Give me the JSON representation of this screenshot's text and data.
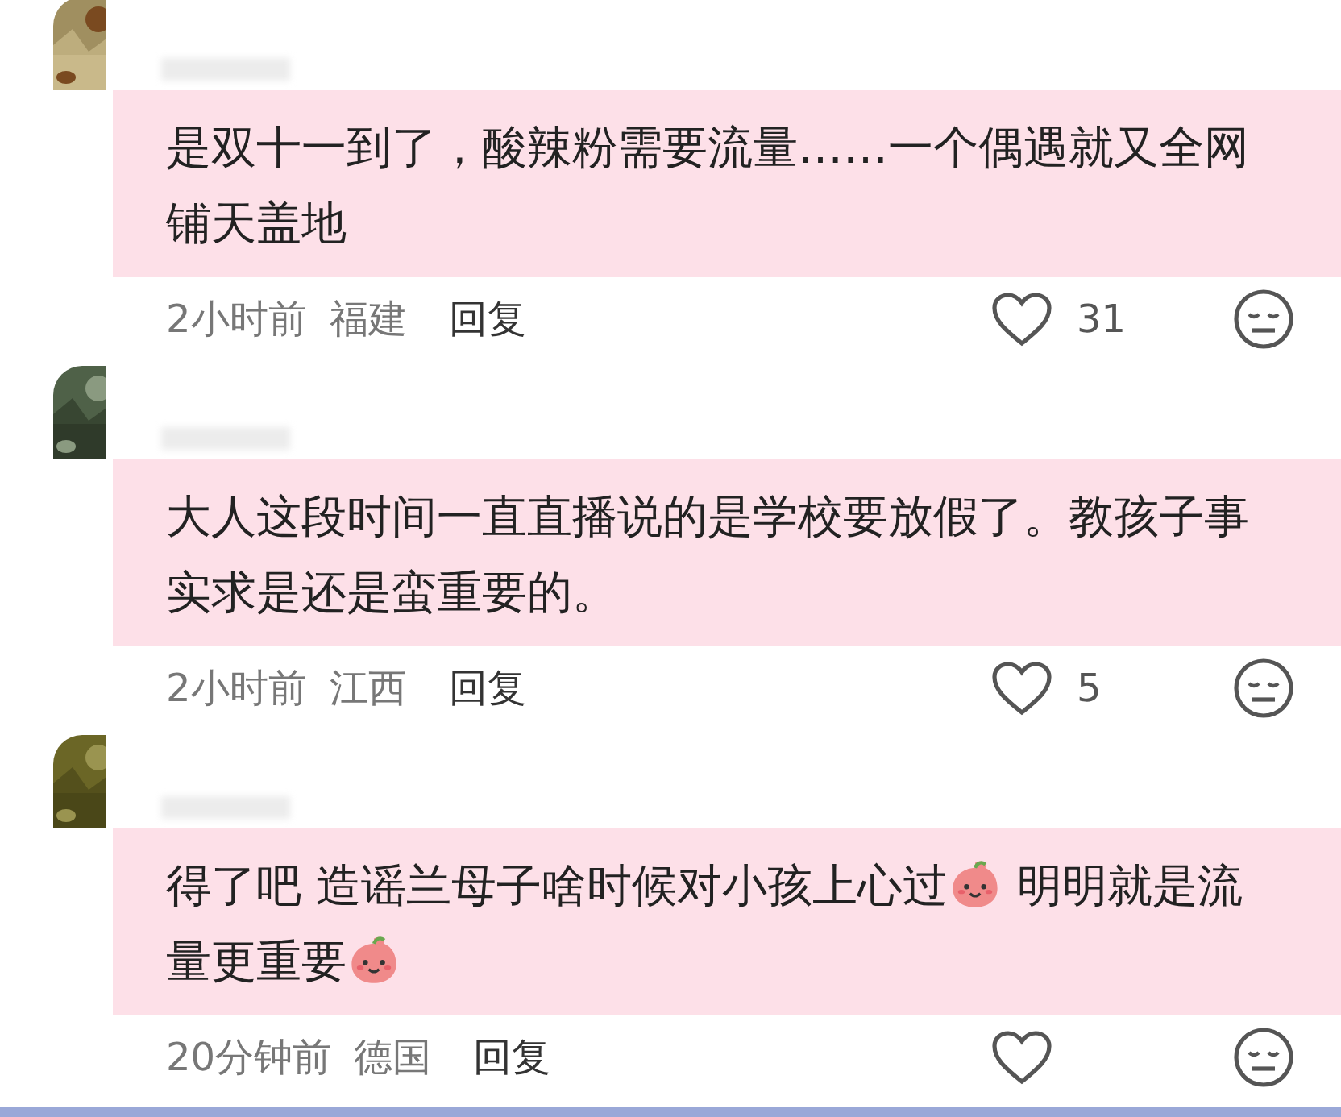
{
  "comments": [
    {
      "segments": [
        {
          "kind": "text",
          "text": "是双十一到了，酸辣粉需要流量……一个偶遇就又全网铺天盖地"
        }
      ],
      "time": "2小时前",
      "location": "福建",
      "reply": "回复",
      "likes": "31"
    },
    {
      "segments": [
        {
          "kind": "text",
          "text": "大人这段时间一直直播说的是学校要放假了。教孩子事实求是还是蛮重要的。"
        }
      ],
      "time": "2小时前",
      "location": "江西",
      "reply": "回复",
      "likes": "5"
    },
    {
      "segments": [
        {
          "kind": "text",
          "text": "得了吧 造谣兰母子啥时候对小孩上心过"
        },
        {
          "kind": "emoji"
        },
        {
          "kind": "text",
          "text": " 明明就是流量更重要"
        },
        {
          "kind": "emoji"
        }
      ],
      "time": "20分钟前",
      "location": "德国",
      "reply": "回复"
    }
  ]
}
